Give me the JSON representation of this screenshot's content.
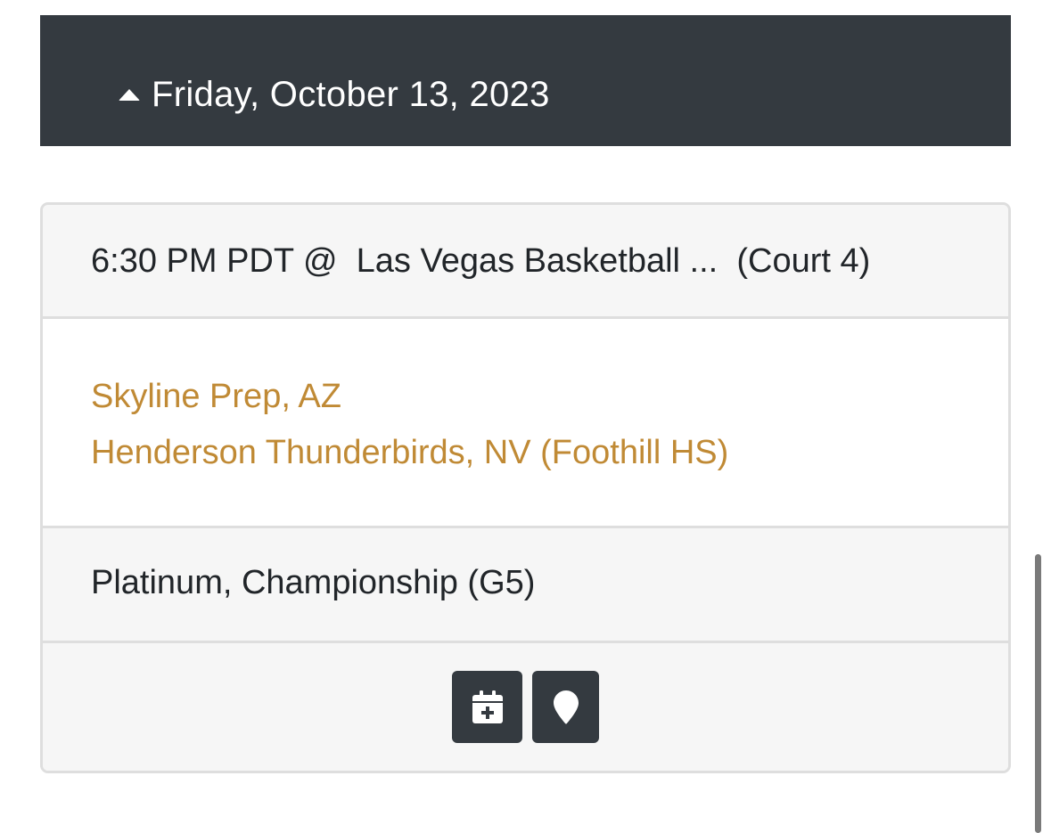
{
  "day_header": {
    "icon": "caret-up-icon",
    "date_label": "Friday, October 13, 2023"
  },
  "game": {
    "time": "6:30 PM PDT @ ",
    "venue": "Las Vegas Basketball ...",
    "court": "(Court 4)",
    "teams": [
      "Skyline Prep, AZ",
      "Henderson Thunderbirds, NV (Foothill HS)"
    ],
    "division": "Platinum, Championship (G5)",
    "actions": [
      {
        "icon": "calendar-plus-icon"
      },
      {
        "icon": "map-marker-icon"
      }
    ]
  },
  "colors": {
    "header_bg": "#343a40",
    "team_link": "#c08a35",
    "row_bg": "#f6f6f6",
    "border": "#dedede"
  }
}
